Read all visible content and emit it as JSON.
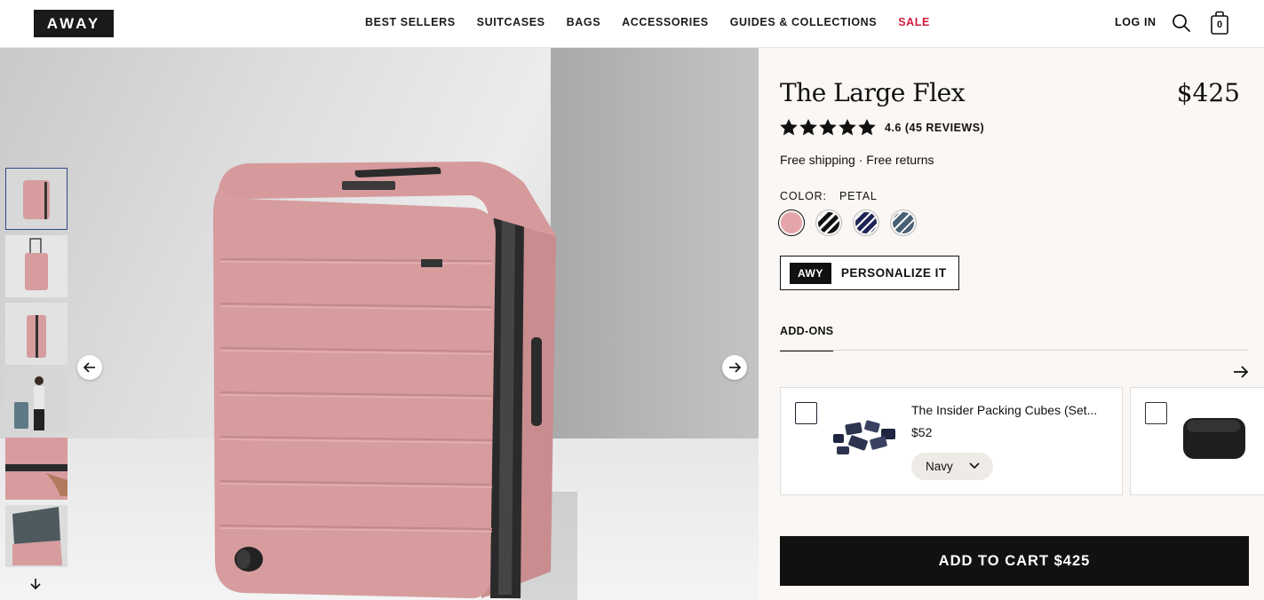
{
  "brand": {
    "logo": "AWAY"
  },
  "nav": {
    "items": [
      {
        "label": "BEST SELLERS"
      },
      {
        "label": "SUITCASES"
      },
      {
        "label": "BAGS"
      },
      {
        "label": "ACCESSORIES"
      },
      {
        "label": "GUIDES & COLLECTIONS"
      },
      {
        "label": "SALE"
      }
    ],
    "login": "LOG IN",
    "cart_count": "0",
    "sale_color": "#d01c3d"
  },
  "gallery": {
    "thumbnails": [
      "suitcase-front",
      "suitcase-handle-extended",
      "suitcase-side",
      "person-with-suitcase",
      "hand-on-zipper",
      "suitcase-open"
    ],
    "active_index": 0
  },
  "product": {
    "title": "The Large Flex",
    "price": "$425",
    "rating_value": 4.6,
    "rating_text": "4.6 (45 REVIEWS)",
    "shipping": "Free shipping · Free returns",
    "color_label": "COLOR:",
    "color_value": "PETAL",
    "swatches": [
      {
        "name": "petal",
        "color": "#e4a5a8"
      },
      {
        "name": "black-white-stripe",
        "color": "#111111"
      },
      {
        "name": "navy-stripe",
        "color": "#1f2456"
      },
      {
        "name": "slate-stripe",
        "color": "#4a6074"
      }
    ],
    "personalize_badge": "AWY",
    "personalize_label": "PERSONALIZE IT",
    "addons_tab": "ADD-ONS",
    "addons": [
      {
        "name": "The Insider Packing Cubes (Set...",
        "price": "$52",
        "option": "Navy"
      },
      {
        "name": "",
        "price": "",
        "option": ""
      }
    ],
    "cart_button": "ADD TO CART $425"
  }
}
